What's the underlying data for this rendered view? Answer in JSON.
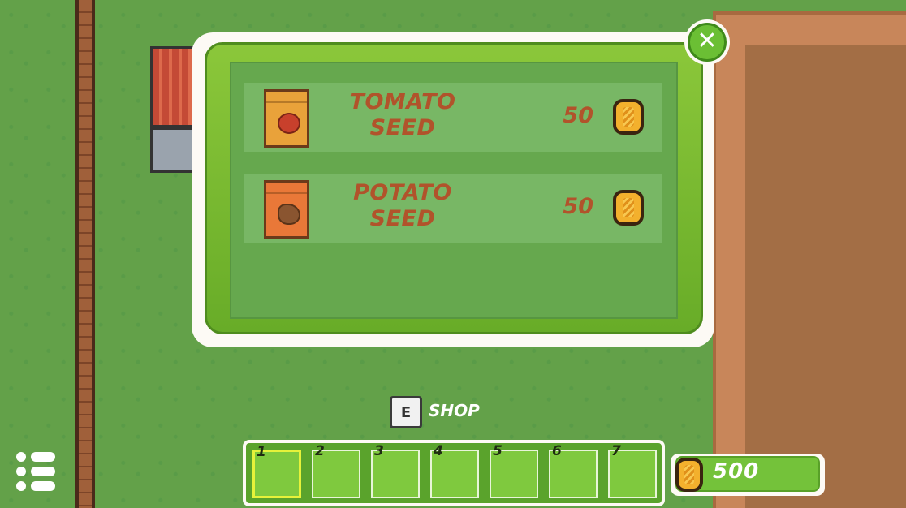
{
  "shop": {
    "items": [
      {
        "name_line1": "TOMATO",
        "name_line2": "SEED",
        "price": "50",
        "icon": "tomato-seed-packet-icon"
      },
      {
        "name_line1": "POTATO",
        "name_line2": "SEED",
        "price": "50",
        "icon": "potato-seed-packet-icon"
      }
    ],
    "close_icon": "✕"
  },
  "prompt": {
    "key": "E",
    "label": "SHOP"
  },
  "hotbar": {
    "slots": [
      "1",
      "2",
      "3",
      "4",
      "5",
      "6",
      "7"
    ],
    "selected_slot": "1"
  },
  "wallet": {
    "coins": "500",
    "icon": "coin-icon"
  },
  "menu": {
    "icon": "menu-icon"
  },
  "colors": {
    "text_brown": "#b1532b",
    "panel_green": "#78b765",
    "frame_green": "#6bbf34"
  }
}
